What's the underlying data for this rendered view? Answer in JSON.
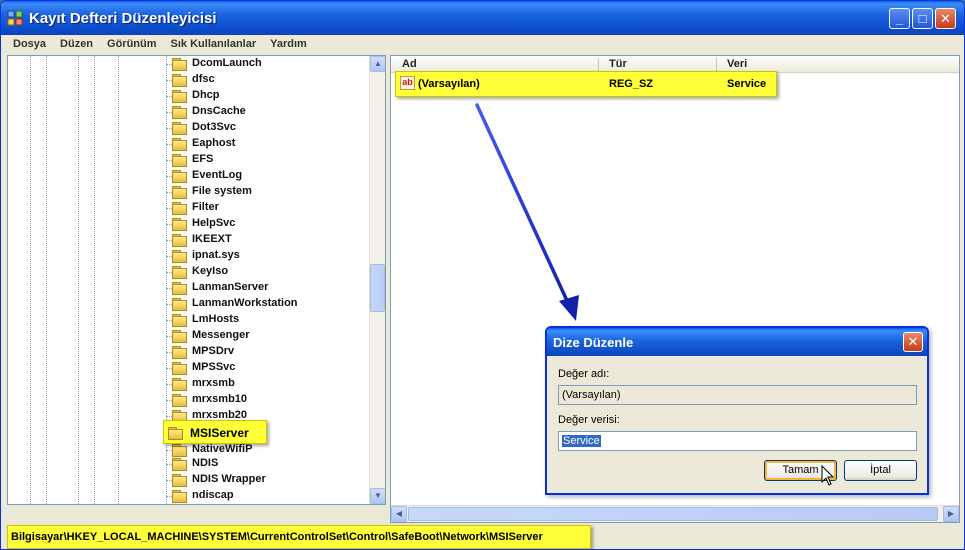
{
  "window": {
    "title": "Kayıt Defteri Düzenleyicisi",
    "minimize_symbol": "_",
    "maximize_symbol": "□",
    "close_symbol": "✕"
  },
  "menu": [
    "Dosya",
    "Düzen",
    "Görünüm",
    "Sık Kullanılanlar",
    "Yardım"
  ],
  "tree": {
    "items": [
      "DcomLaunch",
      "dfsc",
      "Dhcp",
      "DnsCache",
      "Dot3Svc",
      "Eaphost",
      "EFS",
      "EventLog",
      "File system",
      "Filter",
      "HelpSvc",
      "IKEEXT",
      "ipnat.sys",
      "KeyIso",
      "LanmanServer",
      "LanmanWorkstation",
      "LmHosts",
      "Messenger",
      "MPSDrv",
      "MPSSvc",
      "mrxsmb",
      "mrxsmb10",
      "mrxsmb20",
      "MSIServer",
      "NativeWifiP",
      "NDIS",
      "NDIS Wrapper",
      "ndiscap"
    ],
    "selected": "MSIServer"
  },
  "list": {
    "columns": [
      "Ad",
      "Tür",
      "Veri"
    ],
    "rows": [
      {
        "name": "(Varsayılan)",
        "type": "REG_SZ",
        "data": "Service",
        "icon": "string-value-icon"
      }
    ]
  },
  "statusbar": {
    "path": "Bilgisayar\\HKEY_LOCAL_MACHINE\\SYSTEM\\CurrentControlSet\\Control\\SafeBoot\\Network\\MSIServer"
  },
  "dialog": {
    "title": "Dize Düzenle",
    "close_symbol": "✕",
    "value_name_label": "Değer adı:",
    "value_name": "(Varsayılan)",
    "value_data_label": "Değer verisi:",
    "value_data": "Service",
    "ok_label": "Tamam",
    "cancel_label": "İptal"
  },
  "colors": {
    "highlight": "#ffff3a",
    "arrow": "#1a2fd0",
    "titlebar": "#0a44b8"
  },
  "scroll_arrows": {
    "up": "▲",
    "down": "▼",
    "left": "◀",
    "right": "▶"
  }
}
